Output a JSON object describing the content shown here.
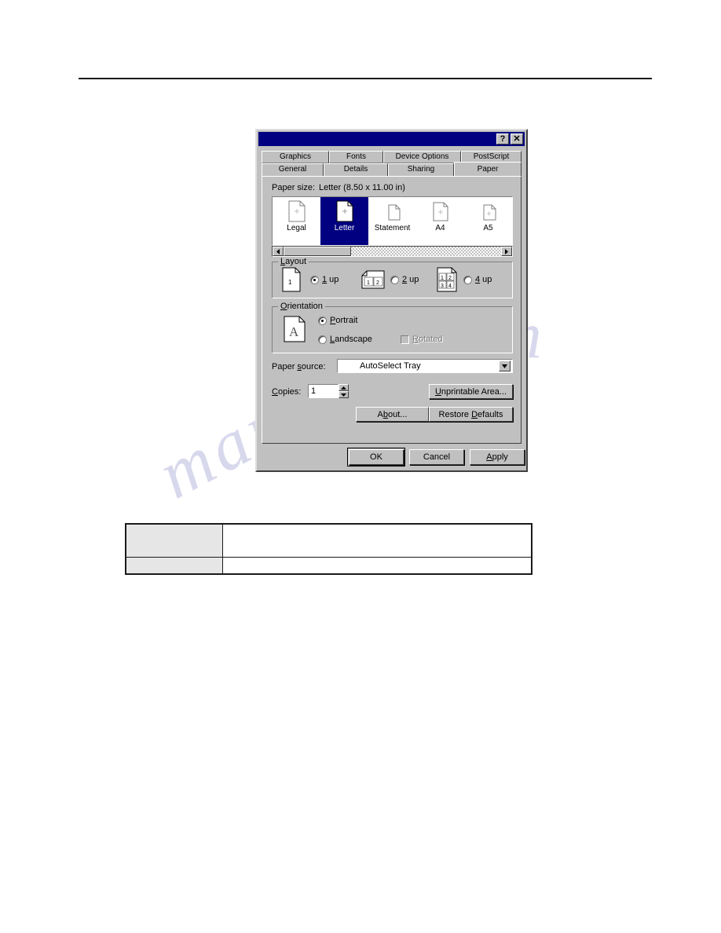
{
  "page": {
    "horizontal_rule": true
  },
  "watermark": {
    "line1": "e .com",
    "line2": "manualsnive"
  },
  "dialog": {
    "titlebar": {
      "title": "",
      "help_button": "?",
      "close_button": "✕"
    },
    "tabs_row1": [
      {
        "label": "Graphics",
        "selected": false
      },
      {
        "label": "Fonts",
        "selected": false
      },
      {
        "label": "Device Options",
        "selected": false
      },
      {
        "label": "PostScript",
        "selected": false
      }
    ],
    "tabs_row2": [
      {
        "label": "General",
        "selected": false
      },
      {
        "label": "Details",
        "selected": false
      },
      {
        "label": "Sharing",
        "selected": false
      },
      {
        "label": "Paper",
        "selected": true
      }
    ],
    "paper_size": {
      "label": "Paper size:",
      "value": "Letter (8.50 x 11.00 in)",
      "items": [
        {
          "name": "Legal",
          "selected": false
        },
        {
          "name": "Letter",
          "selected": true
        },
        {
          "name": "Statement",
          "selected": false
        },
        {
          "name": "A4",
          "selected": false
        },
        {
          "name": "A5",
          "selected": false
        }
      ],
      "scroll_left_arrow": "◄",
      "scroll_right_arrow": "►"
    },
    "layout": {
      "title": "Layout",
      "options": [
        {
          "label_pre": "",
          "label_accel": "1",
          "label_post": " up",
          "selected": true
        },
        {
          "label_pre": "",
          "label_accel": "2",
          "label_post": " up",
          "selected": false
        },
        {
          "label_pre": "",
          "label_accel": "4",
          "label_post": " up",
          "selected": false
        }
      ],
      "preview_1up": [
        "1"
      ],
      "preview_2up": [
        "1",
        "2"
      ],
      "preview_4up": [
        "1",
        "2",
        "3",
        "4"
      ]
    },
    "orientation": {
      "title": "Orientation",
      "preview_glyph": "A",
      "portrait": {
        "label_accel": "P",
        "label_post": "ortrait",
        "selected": true
      },
      "landscape": {
        "label_accel": "L",
        "label_post": "andscape",
        "selected": false
      },
      "rotated": {
        "label_accel": "R",
        "label_post": "otated",
        "checked": false,
        "disabled": true
      }
    },
    "paper_source": {
      "label": "Paper source:",
      "value": "AutoSelect Tray",
      "arrow": "▼"
    },
    "copies": {
      "label": "Copies:",
      "value": "1",
      "up_arrow": "▲",
      "down_arrow": "▼"
    },
    "buttons": {
      "unprintable_area": {
        "pre": "U",
        "post": "nprintable Area..."
      },
      "about": {
        "pre": "A",
        "mid": "b",
        "post": "out..."
      },
      "restore_defaults": {
        "pre": "Restore ",
        "accel": "D",
        "post": "efaults"
      }
    },
    "footer": {
      "ok": "OK",
      "cancel": "Cancel",
      "apply_accel": "A",
      "apply_post": "pply"
    }
  },
  "bottom_table": {
    "rows": [
      {
        "label": "",
        "value": ""
      },
      {
        "label": "",
        "value": ""
      }
    ]
  }
}
